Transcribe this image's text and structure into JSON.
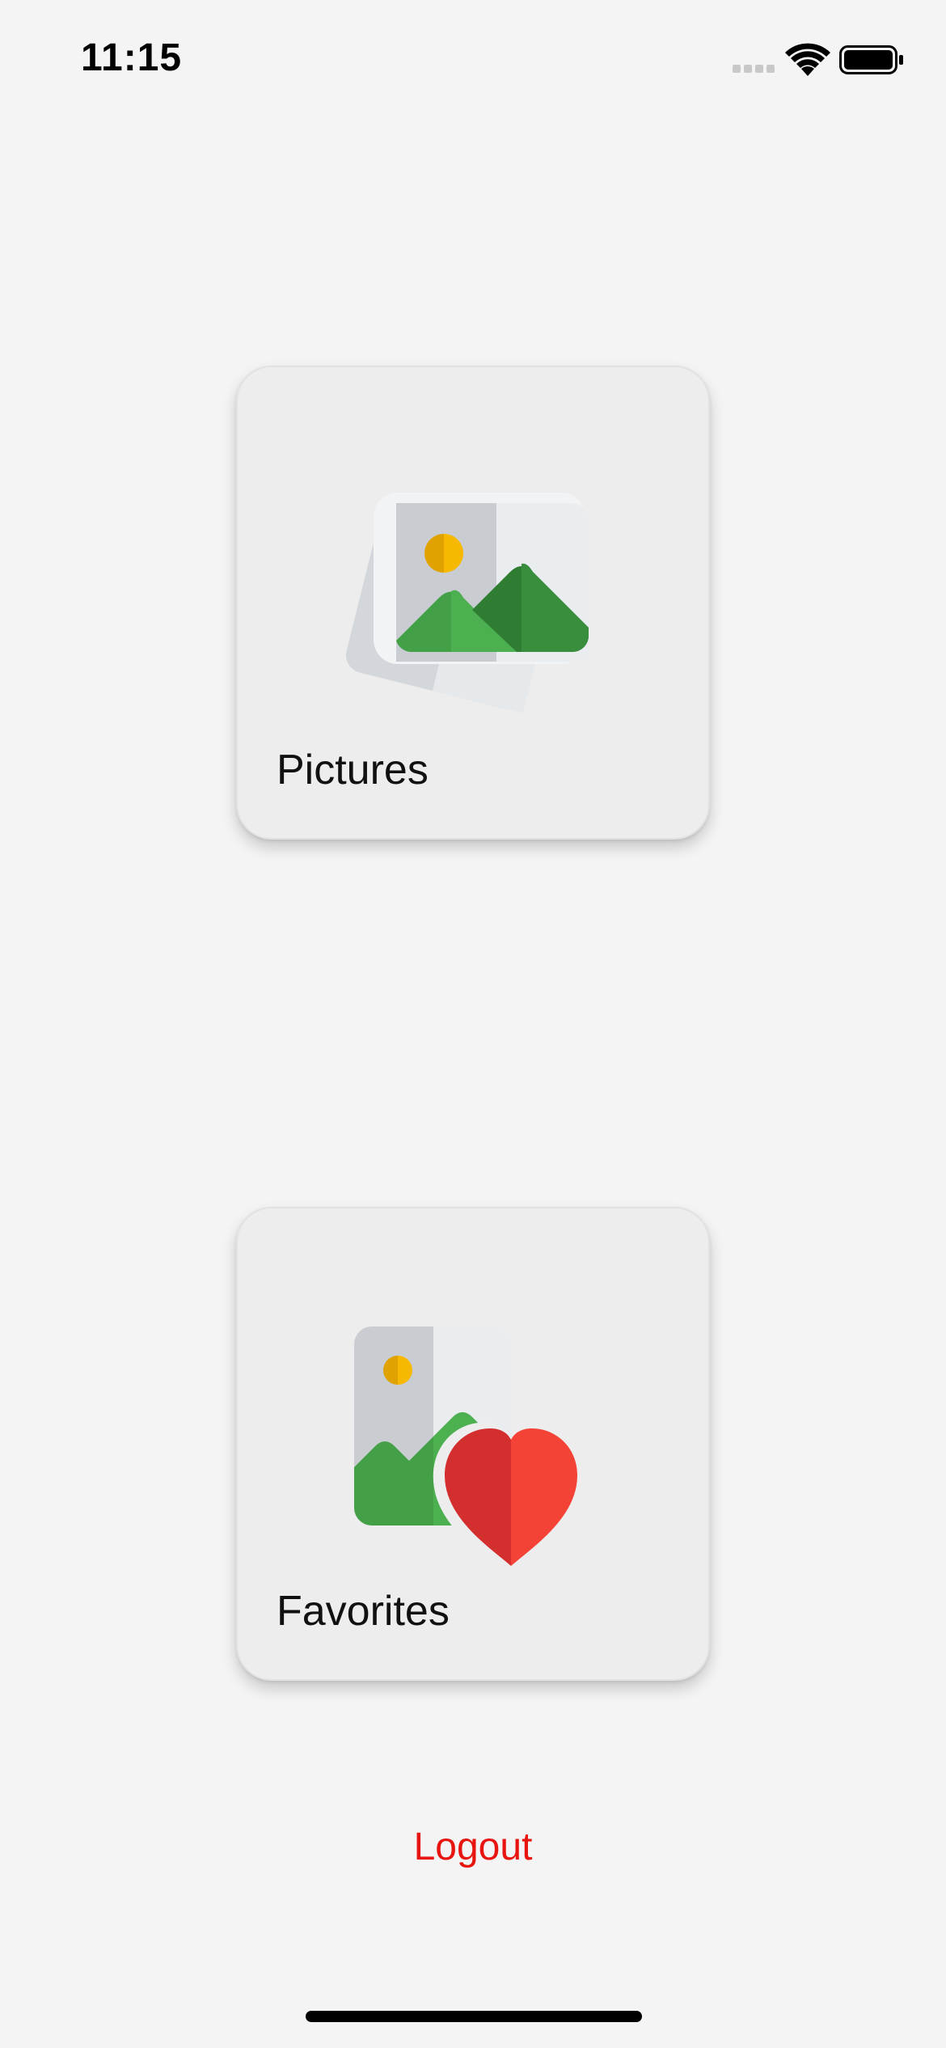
{
  "status_bar": {
    "time": "11:15",
    "icons": [
      "cellular-signal-icon",
      "wifi-icon",
      "battery-icon"
    ]
  },
  "cards": [
    {
      "label": "Pictures",
      "icon": "pictures-icon"
    },
    {
      "label": "Favorites",
      "icon": "favorites-icon"
    }
  ],
  "logout_label": "Logout",
  "colors": {
    "background": "#f4f4f4",
    "card": "#ededed",
    "logout": "#e8140f",
    "green": "#43a047",
    "sun": "#f5b400",
    "heart": "#f44336"
  }
}
